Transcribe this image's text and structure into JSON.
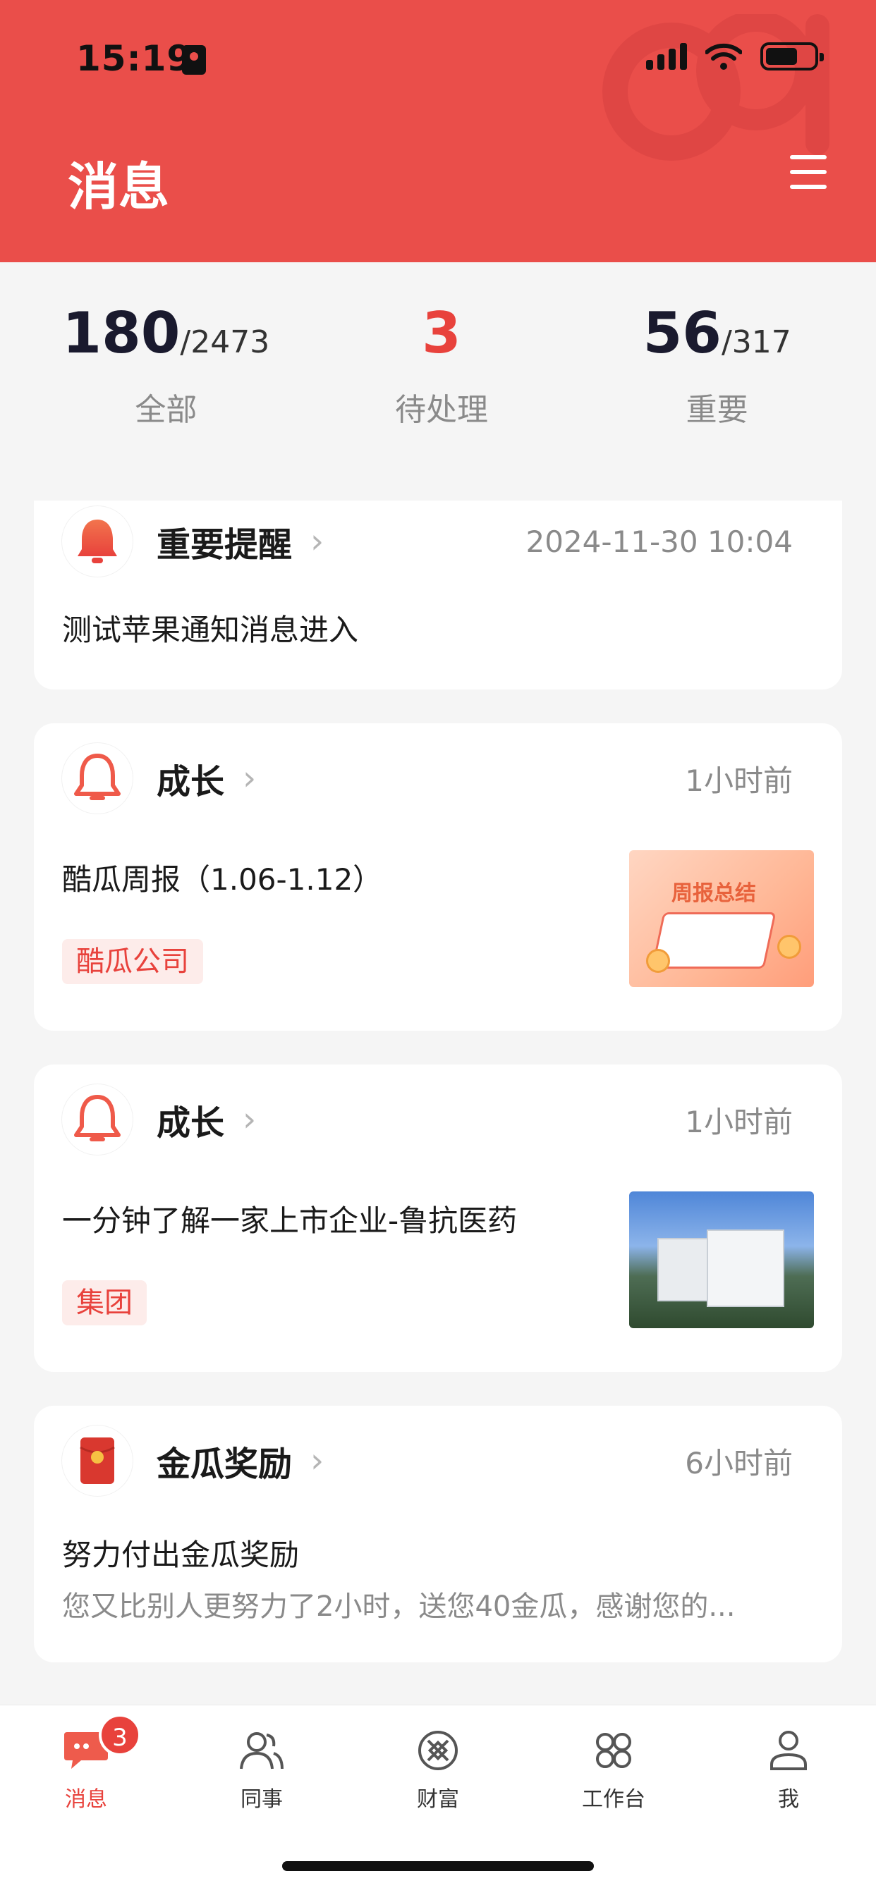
{
  "status_bar": {
    "time": "15:19"
  },
  "header": {
    "title": "消息"
  },
  "stats": [
    {
      "value": "180",
      "total": "/2473",
      "label": "全部"
    },
    {
      "value": "3",
      "total": "",
      "label": "待处理"
    },
    {
      "value": "56",
      "total": "/317",
      "label": "重要"
    }
  ],
  "cards": [
    {
      "category": "重要提醒",
      "time": "2024-11-30 10:04",
      "title": "测试苹果通知消息进入",
      "icon": "bell-filled-icon"
    },
    {
      "category": "成长",
      "time": "1小时前",
      "title": "酷瓜周报（1.06-1.12）",
      "tag": "酷瓜公司",
      "thumb_text": "周报总结",
      "icon": "bell-outline-icon"
    },
    {
      "category": "成长",
      "time": "1小时前",
      "title": "一分钟了解一家上市企业-鲁抗医药",
      "tag": "集团",
      "icon": "bell-outline-icon"
    },
    {
      "category": "金瓜奖励",
      "time": "6小时前",
      "title": "努力付出金瓜奖励",
      "subtitle": "您又比别人更努力了2小时，送您40金瓜，感谢您的...",
      "icon": "red-envelope-icon"
    }
  ],
  "tabbar": {
    "items": [
      {
        "label": "消息",
        "icon": "chat-icon",
        "badge": "3",
        "active": true
      },
      {
        "label": "同事",
        "icon": "people-icon"
      },
      {
        "label": "财富",
        "icon": "wealth-icon"
      },
      {
        "label": "工作台",
        "icon": "workspace-icon"
      },
      {
        "label": "我",
        "icon": "person-icon"
      }
    ]
  },
  "colors": {
    "brand": "#ea4e4a",
    "accent_red": "#e8423c",
    "background": "#f5f5f5"
  }
}
